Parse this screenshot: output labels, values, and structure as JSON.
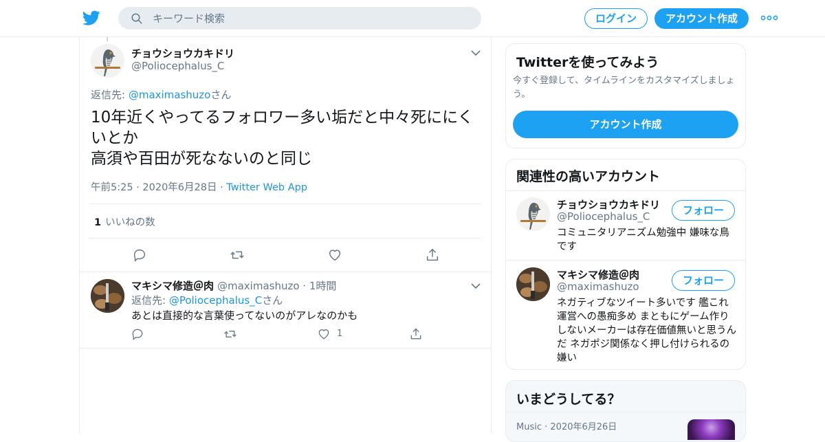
{
  "header": {
    "search_placeholder": "キーワード検索",
    "login_label": "ログイン",
    "signup_label": "アカウント作成",
    "brand_color": "#1da1f2"
  },
  "tweet": {
    "display_name": "チョウショウカキドリ",
    "handle": "@Poliocephalus_C",
    "reply_prefix": "返信先: ",
    "reply_target": "@maximashuzo",
    "reply_suffix": "さん",
    "text_line1": "10年近くやってるフォロワー多い垢だと中々死ににくいとか",
    "text_line2": "高須や百田が死なないのと同じ",
    "time": "午前5:25",
    "date": "2020年6月28日",
    "source": "Twitter Web App",
    "like_count": "1",
    "like_label": "いいねの数"
  },
  "reply": {
    "display_name": "マキシマ修造＠肉",
    "handle": "@maximashuzo",
    "time_ago": "1時間",
    "reply_prefix": "返信先: ",
    "reply_target": "@Poliocephalus_C",
    "reply_suffix": "さん",
    "text": "あとは直接的な言葉使ってないのがアレなのかも",
    "like_count": "1"
  },
  "signup_card": {
    "title": "Twitterを使ってみよう",
    "subtitle": "今すぐ登録して、タイムラインをカスタマイズしましょう。",
    "button": "アカウント作成"
  },
  "related_card": {
    "title": "関連性の高いアカウント",
    "accounts": [
      {
        "display_name": "チョウショウカキドリ",
        "handle": "@Poliocephalus_C",
        "follow_label": "フォロー",
        "bio": "コミュニタリアニズム勉強中 嫌味な鳥です"
      },
      {
        "display_name": "マキシマ修造＠肉",
        "handle": "@maximashuzo",
        "follow_label": "フォロー",
        "bio": "ネガティブなツイート多いです 艦これ運営への愚痴多め まともにゲーム作りしないメーカーは存在価値無いと思うんだ ネガポジ関係なく押し付けられるの嫌い"
      }
    ]
  },
  "trends_card": {
    "title": "いまどうしてる？",
    "item_category": "Music",
    "item_date": "2020年6月26日"
  }
}
